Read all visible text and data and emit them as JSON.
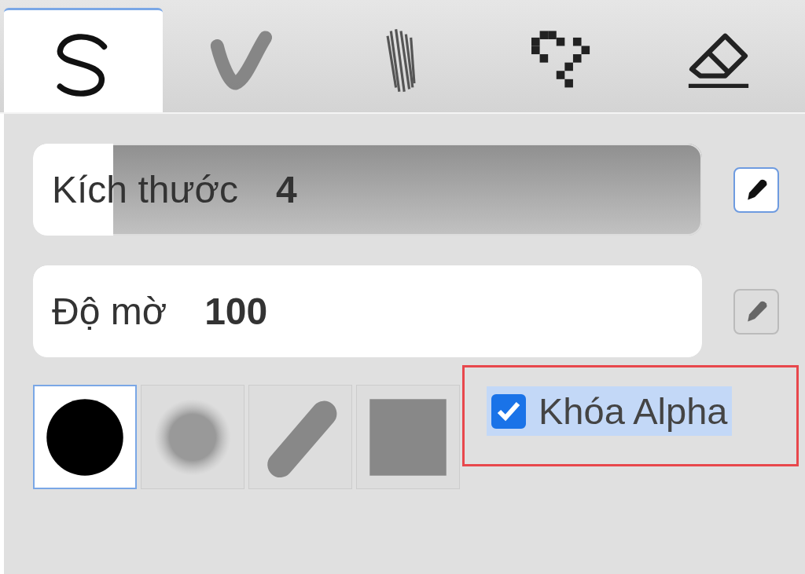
{
  "tabs": [
    {
      "kind": "stroke",
      "selected": true
    },
    {
      "kind": "brush",
      "selected": false
    },
    {
      "kind": "hatch",
      "selected": false
    },
    {
      "kind": "pixel",
      "selected": false
    },
    {
      "kind": "eraser",
      "selected": false
    }
  ],
  "sliders": [
    {
      "label": "Kích thước",
      "value": "4",
      "level": 0.12,
      "pressure": true
    },
    {
      "label": "Độ mờ",
      "value": "100",
      "level": 1,
      "pressure": false
    }
  ],
  "shapes": [
    {
      "kind": "circle",
      "selected": true
    },
    {
      "kind": "soft",
      "selected": false
    },
    {
      "kind": "capsule",
      "selected": false
    },
    {
      "kind": "square",
      "selected": false
    }
  ],
  "alpha_lock": {
    "label": "Khóa Alpha",
    "checked": true,
    "highlighted": true
  }
}
